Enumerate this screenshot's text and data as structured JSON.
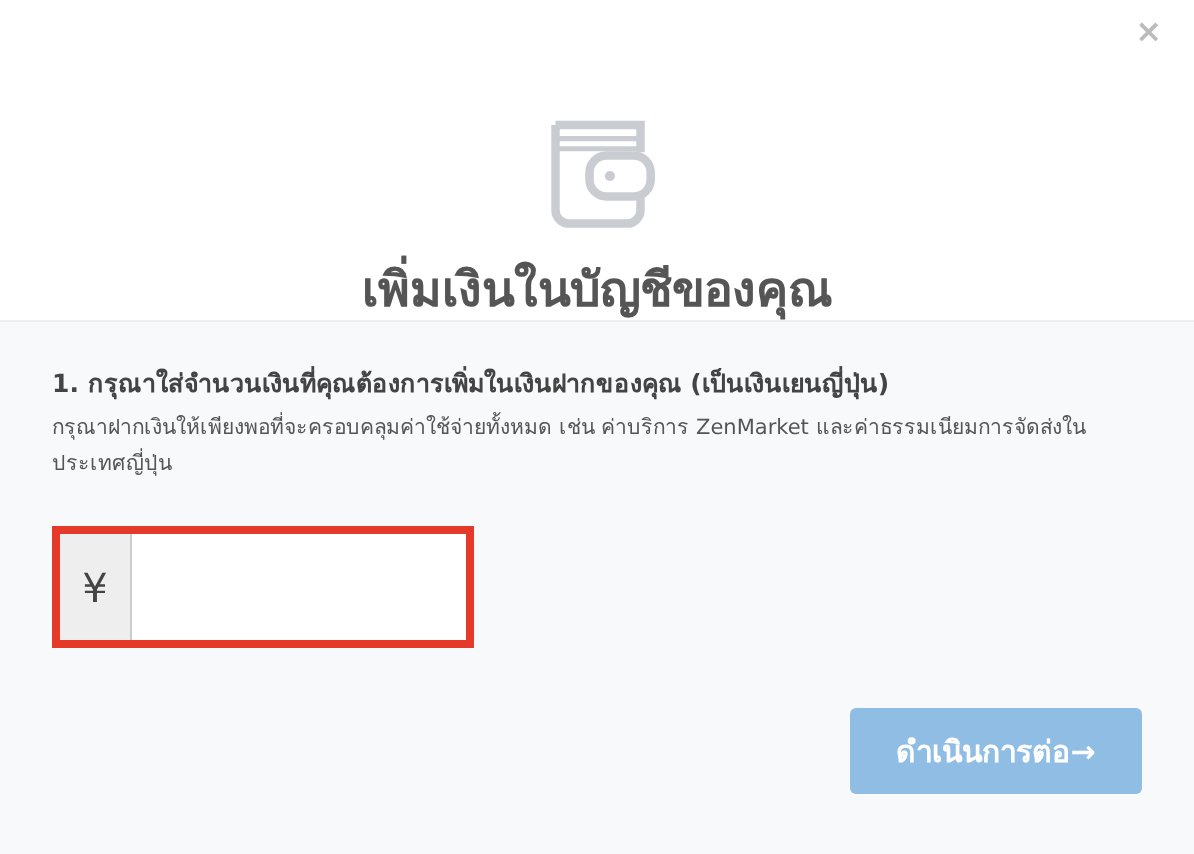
{
  "dialog": {
    "close": "×",
    "title": "เพิ่มเงินในบัญชีของคุณ"
  },
  "form": {
    "label": "1. กรุณาใส่จำนวนเงินที่คุณต้องการเพิ่มในเงินฝากของคุณ (เป็นเงินเยนญี่ปุ่น)",
    "hint": "กรุณาฝากเงินให้เพียงพอที่จะครอบคลุมค่าใช้จ่ายทั้งหมด เช่น ค่าบริการ ZenMarket และค่าธรรมเนียมการจัดส่งในประเทศญี่ปุ่น",
    "currency": "¥",
    "highlighted": true
  },
  "button": {
    "label": "ดำเนินการต่อ→",
    "disabled": true
  }
}
